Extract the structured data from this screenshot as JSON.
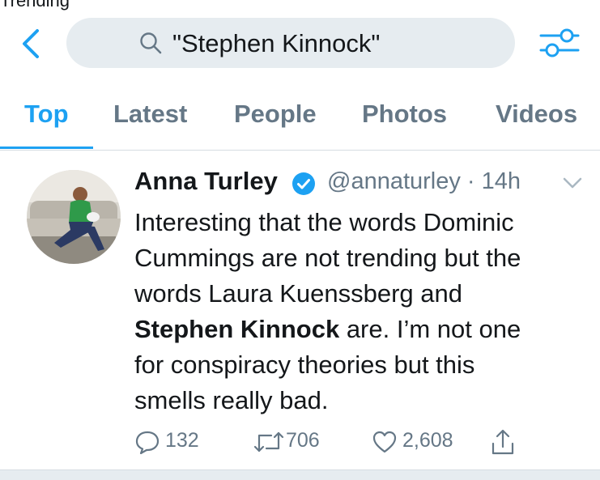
{
  "status_bar": {
    "text": "Trending"
  },
  "search": {
    "query": "\"Stephen Kinnock\""
  },
  "tabs": [
    {
      "label": "Top",
      "active": true
    },
    {
      "label": "Latest",
      "active": false
    },
    {
      "label": "People",
      "active": false
    },
    {
      "label": "Photos",
      "active": false
    },
    {
      "label": "Videos",
      "active": false
    }
  ],
  "tweet": {
    "author_name": "Anna Turley",
    "verified": true,
    "handle_time": "@annaturley · 14h",
    "body_lines": [
      {
        "text": "Interesting that the words Dominic"
      },
      {
        "text": "Cummings are not trending but the"
      },
      {
        "text": "words Laura Kuenssberg and"
      },
      {
        "bold": "Stephen Kinnock",
        "text": " are. I’m not one"
      },
      {
        "text": "for conspiracy theories but this"
      },
      {
        "text": "smells really bad."
      }
    ],
    "replies": "132",
    "retweets": "706",
    "likes": "2,608"
  },
  "colors": {
    "accent": "#1da1f2",
    "text_primary": "#14171a",
    "text_secondary": "#657786",
    "search_bg": "#e6ecf0"
  },
  "icons": [
    "back-chevron-icon",
    "search-icon",
    "filter-sliders-icon",
    "verified-badge-icon",
    "caret-down-icon",
    "reply-icon",
    "retweet-icon",
    "like-heart-icon",
    "share-icon"
  ]
}
